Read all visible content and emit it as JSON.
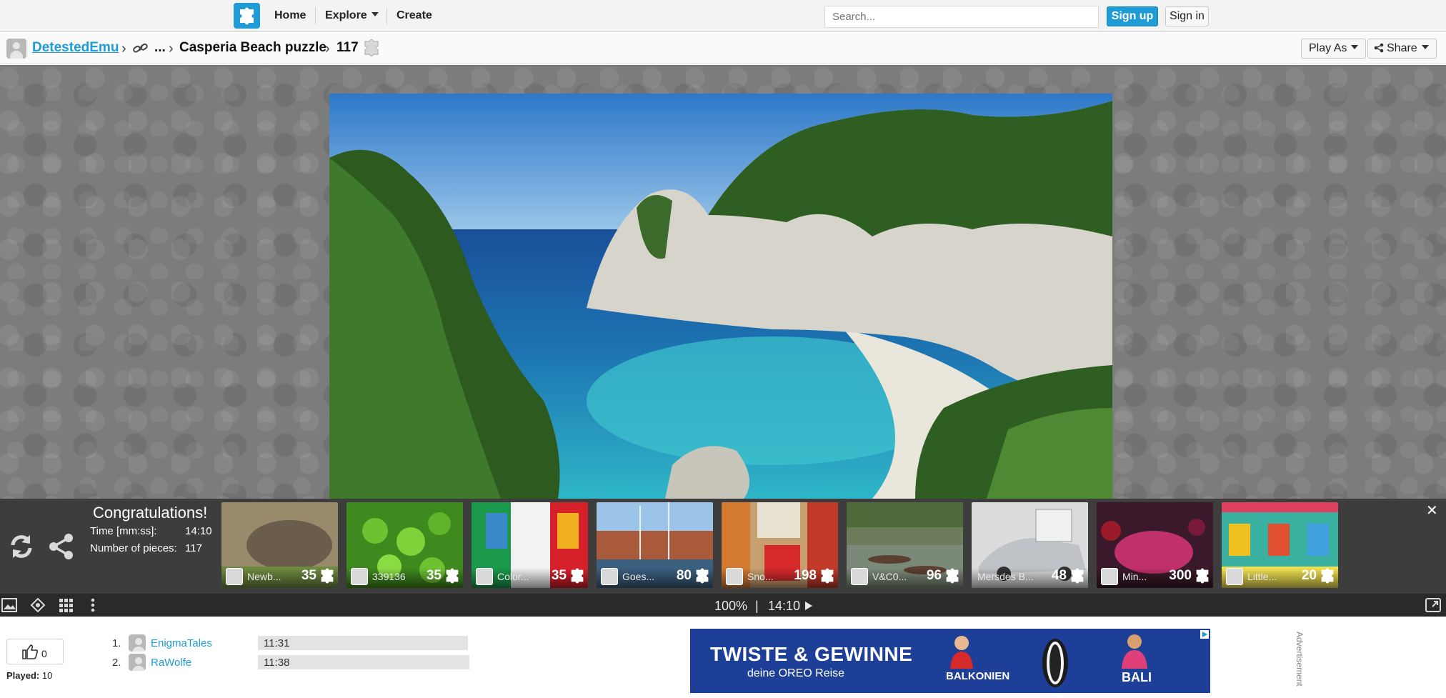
{
  "topnav": {
    "home": "Home",
    "explore": "Explore",
    "create": "Create",
    "search_placeholder": "Search...",
    "signup": "Sign up",
    "signin": "Sign in"
  },
  "breadcrumb": {
    "user": "DetestedEmu",
    "ellipsis": "...",
    "puzzle": "Casperia Beach puzzle",
    "pieces": "117",
    "play_as": "Play As",
    "share": "Share"
  },
  "result": {
    "title": "Congratulations!",
    "time_label": "Time [mm:ss]:",
    "time_value": "14:10",
    "pieces_label": "Number of pieces:",
    "pieces_value": "117"
  },
  "thumbnails": [
    {
      "name": "Newb...",
      "count": "35",
      "theme": "rhino"
    },
    {
      "name": "339136",
      "count": "35",
      "theme": "peas"
    },
    {
      "name": "Color...",
      "count": "35",
      "theme": "colors"
    },
    {
      "name": "Goes...",
      "count": "80",
      "theme": "harbor"
    },
    {
      "name": "Sno...",
      "count": "198",
      "theme": "street"
    },
    {
      "name": "V&C0...",
      "count": "96",
      "theme": "boats"
    },
    {
      "name": "Mersdes B...",
      "count": "48",
      "theme": "car"
    },
    {
      "name": "Min...",
      "count": "300",
      "theme": "cake"
    },
    {
      "name": "Little...",
      "count": "20",
      "theme": "houses"
    }
  ],
  "toolbar": {
    "zoom": "100%",
    "separator": "|",
    "timer": "14:10"
  },
  "likes": {
    "count": "0",
    "played_label": "Played:",
    "played_value": "10"
  },
  "leaderboard": [
    {
      "rank": "1.",
      "name": "EnigmaTales",
      "time": "11:31"
    },
    {
      "rank": "2.",
      "name": "RaWolfe",
      "time": "11:38"
    }
  ],
  "ad": {
    "headline": "TWISTE & GEWINNE",
    "subline": "deine OREO Reise",
    "location1": "BALKONIEN",
    "location2": "BALI",
    "label": "Advertisement"
  },
  "colors": {
    "accent": "#1f9bd6",
    "panel": "#3d3d3d",
    "toolbar": "#2a2a2a"
  }
}
